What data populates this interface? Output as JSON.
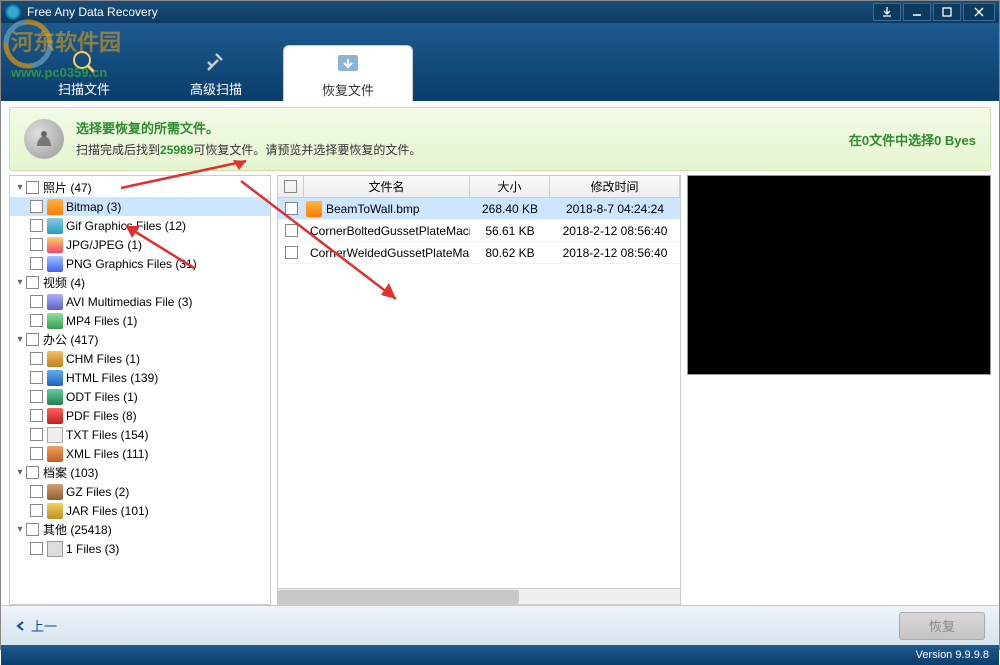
{
  "title": "Free Any Data Recovery",
  "watermark": "河东软件园",
  "watermark_url": "www.pc0359.cn",
  "tabs": [
    {
      "label": "扫描文件"
    },
    {
      "label": "高级扫描"
    },
    {
      "label": "恢复文件"
    }
  ],
  "info": {
    "heading": "选择要恢复的所需文件。",
    "prefix": "扫描完成后找到",
    "count": "25989",
    "suffix": "可恢复文件。请预览并选择要恢复的文件。",
    "status": "在0文件中选择0 Byes"
  },
  "tree": [
    {
      "label": "照片 (47)",
      "depth": 0,
      "cat": true,
      "exp": "▾"
    },
    {
      "label": "Bitmap (3)",
      "depth": 1,
      "sel": true,
      "ico": "ico-bmp"
    },
    {
      "label": "Gif Graphics Files (12)",
      "depth": 1,
      "ico": "ico-gif"
    },
    {
      "label": "JPG/JPEG (1)",
      "depth": 1,
      "ico": "ico-jpg"
    },
    {
      "label": "PNG Graphics Files (31)",
      "depth": 1,
      "ico": "ico-png"
    },
    {
      "label": "视频 (4)",
      "depth": 0,
      "cat": true,
      "exp": "▾"
    },
    {
      "label": "AVI Multimedias File (3)",
      "depth": 1,
      "ico": "ico-avi"
    },
    {
      "label": "MP4 Files (1)",
      "depth": 1,
      "ico": "ico-mp4"
    },
    {
      "label": "办公 (417)",
      "depth": 0,
      "cat": true,
      "exp": "▾"
    },
    {
      "label": "CHM Files (1)",
      "depth": 1,
      "ico": "ico-chm"
    },
    {
      "label": "HTML Files (139)",
      "depth": 1,
      "ico": "ico-html"
    },
    {
      "label": "ODT Files (1)",
      "depth": 1,
      "ico": "ico-odt"
    },
    {
      "label": "PDF Files (8)",
      "depth": 1,
      "ico": "ico-pdf"
    },
    {
      "label": "TXT Files (154)",
      "depth": 1,
      "ico": "ico-txt"
    },
    {
      "label": "XML Files (111)",
      "depth": 1,
      "ico": "ico-xml"
    },
    {
      "label": "档案 (103)",
      "depth": 0,
      "cat": true,
      "exp": "▾"
    },
    {
      "label": "GZ Files (2)",
      "depth": 1,
      "ico": "ico-gz"
    },
    {
      "label": "JAR Files (101)",
      "depth": 1,
      "ico": "ico-jar"
    },
    {
      "label": "其他 (25418)",
      "depth": 0,
      "cat": true,
      "exp": "▾"
    },
    {
      "label": "1 Files (3)",
      "depth": 1,
      "ico": "ico-1"
    }
  ],
  "columns": {
    "name": "文件名",
    "size": "大小",
    "date": "修改时间"
  },
  "files": [
    {
      "name": "BeamToWall.bmp",
      "size": "268.40 KB",
      "date": "2018-8-7 04:24:24",
      "sel": true
    },
    {
      "name": "CornerBoltedGussetPlateMacr...",
      "size": "56.61 KB",
      "date": "2018-2-12 08:56:40"
    },
    {
      "name": "CornerWeldedGussetPlateMac...",
      "size": "80.62 KB",
      "date": "2018-2-12 08:56:40"
    }
  ],
  "footer": {
    "back": "上一",
    "recover": "恢复"
  },
  "version": "Version 9.9.9.8"
}
